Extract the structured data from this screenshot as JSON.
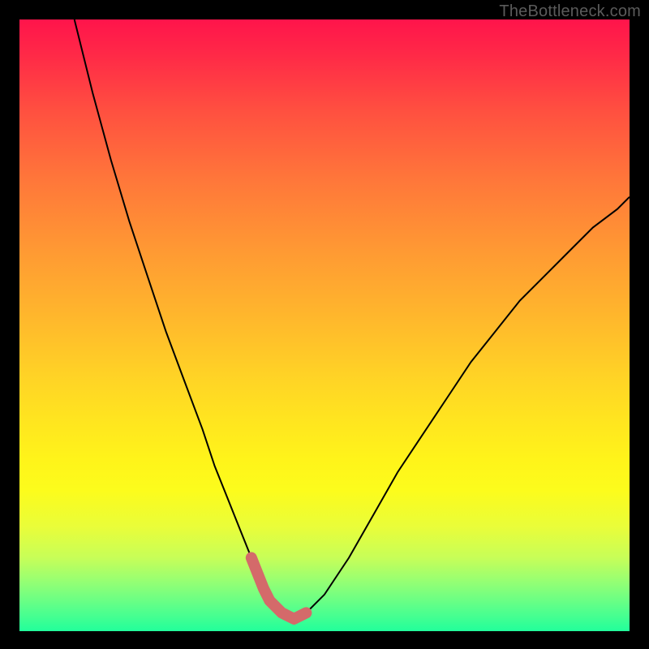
{
  "watermark": "TheBottleneck.com",
  "colors": {
    "frame": "#000000",
    "curve": "#000000",
    "highlight": "#d46a6a",
    "grad_top": "#ff144b",
    "grad_bottom": "#22ff9b"
  },
  "chart_data": {
    "type": "line",
    "title": "",
    "xlabel": "",
    "ylabel": "",
    "xlim": [
      0,
      100
    ],
    "ylim": [
      0,
      100
    ],
    "x": [
      9,
      12,
      15,
      18,
      21,
      24,
      27,
      30,
      32,
      34,
      36,
      38,
      40,
      41,
      43,
      45,
      47,
      50,
      54,
      58,
      62,
      66,
      70,
      74,
      78,
      82,
      86,
      90,
      94,
      98,
      100
    ],
    "values": [
      100,
      88,
      77,
      67,
      58,
      49,
      41,
      33,
      27,
      22,
      17,
      12,
      7,
      5,
      3,
      2,
      3,
      6,
      12,
      19,
      26,
      32,
      38,
      44,
      49,
      54,
      58,
      62,
      66,
      69,
      71
    ],
    "highlight_range_x": [
      38,
      47
    ],
    "annotations": []
  }
}
